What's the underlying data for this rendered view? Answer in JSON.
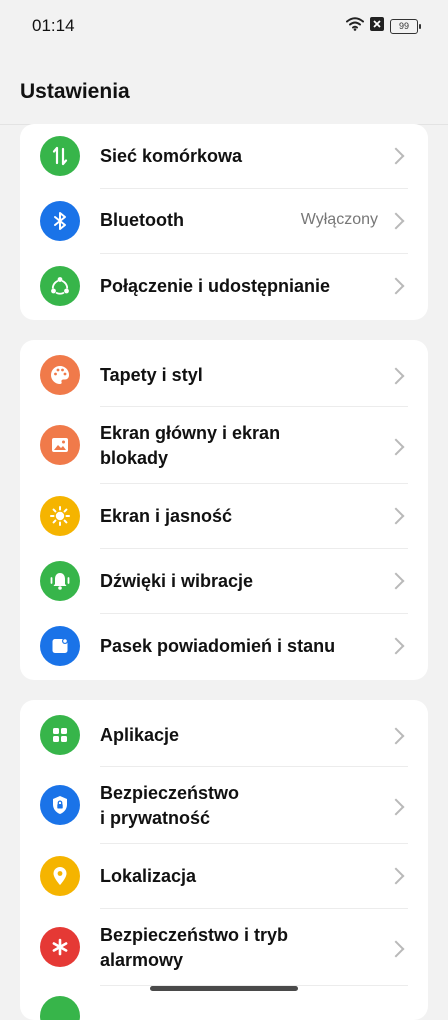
{
  "status_bar": {
    "time": "01:14",
    "battery_level": "99"
  },
  "header": {
    "title": "Ustawienia"
  },
  "colors": {
    "green": "#37b54a",
    "blue": "#1a73e8",
    "orange": "#f07a4a",
    "yellow": "#f5b400",
    "red": "#e53935"
  },
  "groups": [
    {
      "items": [
        {
          "label": "Sieć komórkowa",
          "icon": "mobile-data-icon"
        },
        {
          "label": "Bluetooth",
          "value": "Wyłączony",
          "icon": "bluetooth-icon"
        },
        {
          "label": "Połączenie i udostępnianie",
          "icon": "share-icon"
        }
      ]
    },
    {
      "items": [
        {
          "label": "Tapety i styl",
          "icon": "palette-icon"
        },
        {
          "label_line1": "Ekran główny i ekran",
          "label_line2": "blokady",
          "icon": "image-icon"
        },
        {
          "label": "Ekran i jasność",
          "icon": "brightness-icon"
        },
        {
          "label": "Dźwięki i wibracje",
          "icon": "bell-icon"
        },
        {
          "label": "Pasek powiadomień i stanu",
          "icon": "notification-icon"
        }
      ]
    },
    {
      "items": [
        {
          "label": "Aplikacje",
          "icon": "apps-icon"
        },
        {
          "label_line1": "Bezpieczeństwo",
          "label_line2": "i prywatność",
          "icon": "shield-lock-icon"
        },
        {
          "label": "Lokalizacja",
          "icon": "location-icon"
        },
        {
          "label_line1": "Bezpieczeństwo i tryb",
          "label_line2": "alarmowy",
          "icon": "emergency-icon"
        }
      ]
    }
  ]
}
